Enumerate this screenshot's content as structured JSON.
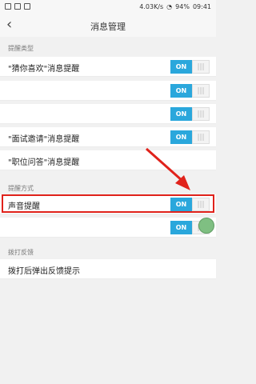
{
  "statusbar": {
    "speed": "4.03K/s",
    "battery": "94%",
    "time": "09:41"
  },
  "header": {
    "back_glyph": "‹",
    "title": "消息管理"
  },
  "sections": {
    "remind_type": "提醒类型",
    "remind_method": "提醒方式",
    "feedback": "拨打反馈"
  },
  "rows": [
    {
      "label": "\"猜你喜欢\"消息提醒",
      "toggle": "ON"
    },
    {
      "label": "",
      "toggle": "ON"
    },
    {
      "label": "",
      "toggle": "ON"
    },
    {
      "label": "\"面试邀请\"消息提醒",
      "toggle": "ON"
    },
    {
      "label": "\"职位问答\"消息提醒",
      "toggle": ""
    },
    {
      "label": "声音提醒",
      "toggle": "ON"
    },
    {
      "label": "",
      "toggle": "ON"
    },
    {
      "label": "拨打后弹出反馈提示",
      "toggle": ""
    }
  ],
  "knob_glyph": "|||",
  "colors": {
    "accent": "#2aa7dc",
    "highlight": "#e0221b",
    "arrow": "#e0221b"
  }
}
